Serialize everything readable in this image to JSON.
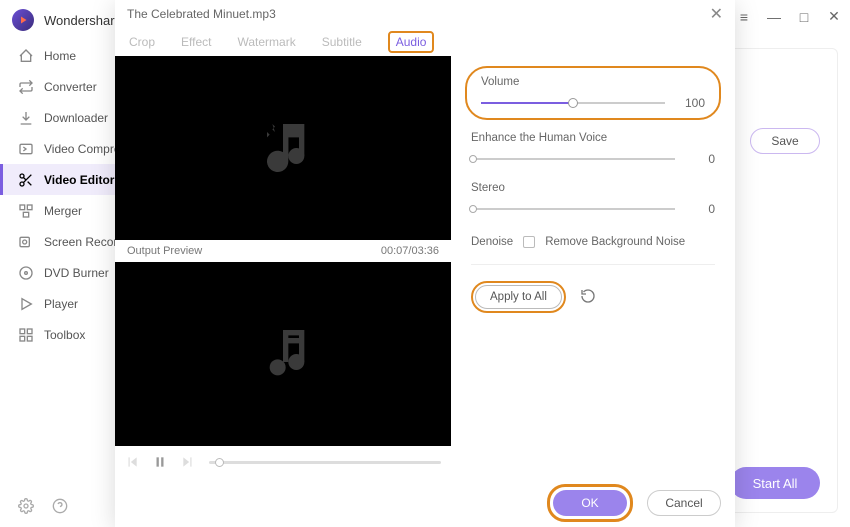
{
  "app": {
    "title": "Wondershare"
  },
  "window_controls": {
    "menu": "≡",
    "minimize": "—",
    "maximize": "□",
    "close": "✕"
  },
  "sidebar": {
    "items": [
      {
        "label": "Home"
      },
      {
        "label": "Converter"
      },
      {
        "label": "Downloader"
      },
      {
        "label": "Video Compressor"
      },
      {
        "label": "Video Editor"
      },
      {
        "label": "Merger"
      },
      {
        "label": "Screen Recorder"
      },
      {
        "label": "DVD Burner"
      },
      {
        "label": "Player"
      },
      {
        "label": "Toolbox"
      }
    ]
  },
  "main": {
    "save_label": "Save",
    "start_all_label": "Start All"
  },
  "modal": {
    "title": "The Celebrated Minuet.mp3",
    "tabs": [
      {
        "label": "Crop"
      },
      {
        "label": "Effect"
      },
      {
        "label": "Watermark"
      },
      {
        "label": "Subtitle"
      },
      {
        "label": "Audio"
      }
    ],
    "active_tab": "Audio",
    "preview_label": "Output Preview",
    "preview_time": "00:07/03:36",
    "controls": {
      "volume": {
        "label": "Volume",
        "value": "100",
        "pct": 50
      },
      "enhance": {
        "label": "Enhance the Human Voice",
        "value": "0",
        "pct": 0
      },
      "stereo": {
        "label": "Stereo",
        "value": "0",
        "pct": 0
      },
      "denoise": {
        "label": "Denoise",
        "checkbox_label": "Remove Background Noise"
      }
    },
    "apply_all_label": "Apply to All",
    "ok_label": "OK",
    "cancel_label": "Cancel"
  }
}
